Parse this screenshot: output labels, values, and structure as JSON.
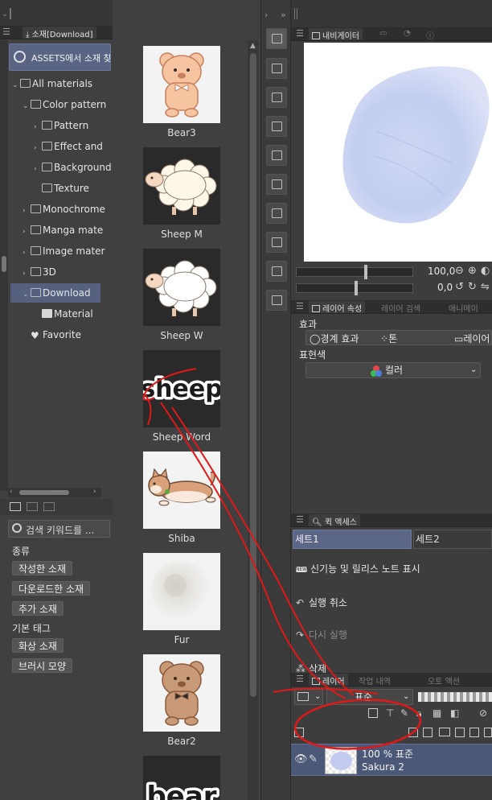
{
  "material_panel": {
    "tab_label": "소재[Download]",
    "assets_button": "ASSETS에서 소재 찾기",
    "tree": [
      {
        "label": "All materials",
        "indent": 0,
        "arrow": "⌄",
        "icon": "grid-icon"
      },
      {
        "label": "Color pattern",
        "indent": 1,
        "arrow": "⌄",
        "icon": "pattern-icon"
      },
      {
        "label": "Pattern",
        "indent": 2,
        "arrow": "›",
        "icon": "pattern-icon"
      },
      {
        "label": "Effect and",
        "indent": 2,
        "arrow": "›",
        "icon": "effect-icon"
      },
      {
        "label": "Background",
        "indent": 2,
        "arrow": "›",
        "icon": "image-icon"
      },
      {
        "label": "Texture",
        "indent": 2,
        "arrow": "",
        "icon": "texture-icon"
      },
      {
        "label": "Monochrome",
        "indent": 1,
        "arrow": "›",
        "icon": "pattern-icon"
      },
      {
        "label": "Manga mate",
        "indent": 1,
        "arrow": "›",
        "icon": "manga-icon"
      },
      {
        "label": "Image mater",
        "indent": 1,
        "arrow": "›",
        "icon": "image-icon"
      },
      {
        "label": "3D",
        "indent": 1,
        "arrow": "›",
        "icon": "cube-icon"
      },
      {
        "label": "Download",
        "indent": 1,
        "arrow": "⌄",
        "icon": "download-icon",
        "selected": true
      },
      {
        "label": "Material",
        "indent": 2,
        "arrow": "",
        "icon": "folder-icon"
      },
      {
        "label": "Favorite",
        "indent": 0,
        "arrow": "",
        "icon": "heart-icon"
      }
    ],
    "search_placeholder": "검색 키워드를 ...",
    "kind_heading": "종류",
    "kind_tags": [
      "작성한 소재",
      "다운로드한 소재",
      "추가 소재"
    ],
    "basic_tag_heading": "기본 태그",
    "basic_tags": [
      "화상 소재",
      "브러시 모양"
    ]
  },
  "thumbnails": [
    {
      "label": "Bear3",
      "kind": "bear-peach"
    },
    {
      "label": "Sheep M",
      "kind": "sheep-dark"
    },
    {
      "label": "Sheep W",
      "kind": "sheep-white"
    },
    {
      "label": "Sheep Word",
      "kind": "word-sheep",
      "word": "sheep"
    },
    {
      "label": "Shiba",
      "kind": "shiba"
    },
    {
      "label": "Fur",
      "kind": "fur"
    },
    {
      "label": "Bear2",
      "kind": "bear-brown"
    },
    {
      "label": "",
      "kind": "word-bear",
      "word": "bear"
    }
  ],
  "navigator": {
    "tab_label": "내비게이터",
    "zoom_value": "100,0",
    "rotate_value": "0,0"
  },
  "layer_props": {
    "tab_label": "레이어 속성",
    "tab2_label": "레이어 검색",
    "tab3_label": "애니메이",
    "effect_heading": "효과",
    "effect_buttons": [
      "경계 효과",
      "톤",
      "레이어"
    ],
    "color_heading": "표현색",
    "color_value": "컬러"
  },
  "quick_access": {
    "tab_label": "퀵 액세스",
    "set_tabs": [
      "세트1",
      "세트2"
    ],
    "items": [
      {
        "label": "신기능 및 릴리스 노트 표시",
        "icon": "new-badge-icon"
      },
      {
        "label": "실행 취소",
        "icon": "undo-icon"
      },
      {
        "label": "다시 실행",
        "icon": "redo-icon"
      },
      {
        "label": "삭제",
        "icon": "loading-icon"
      }
    ]
  },
  "layer_panel": {
    "tab_label": "레이어",
    "tab2_label": "작업 내역",
    "tab3_label": "오토 액션",
    "blend_mode": "표준",
    "layer": {
      "meta": "100 % 표준",
      "name": "Sakura 2"
    }
  },
  "colors": {
    "panel_bg": "#404040",
    "selected_bg": "#55617e",
    "annotation_red": "#e01818",
    "layer_selected_bg": "#4c5877"
  }
}
